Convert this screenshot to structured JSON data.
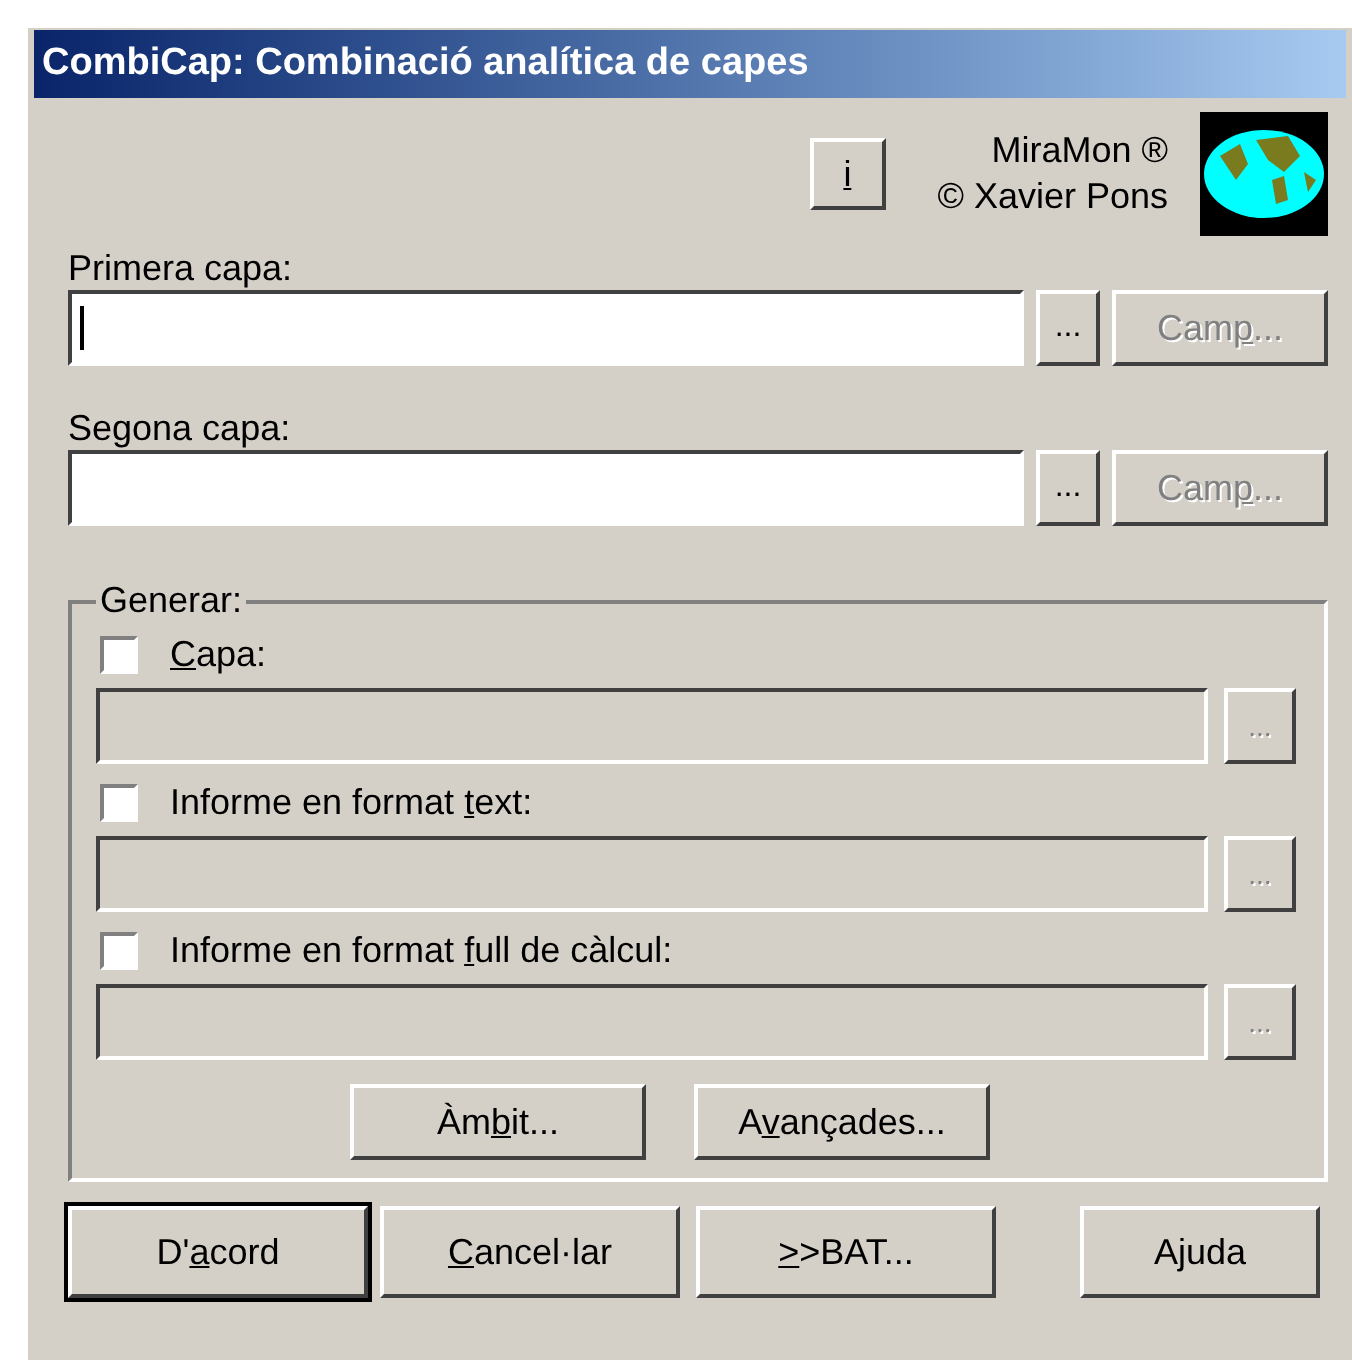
{
  "window": {
    "title": "CombiCap: Combinació analítica de capes"
  },
  "info_button": {
    "label": {
      "key": "i"
    }
  },
  "credits": [
    "MiraMon ®",
    "© Xavier Pons"
  ],
  "layers": [
    {
      "label": "Primera capa:",
      "focused": true,
      "browse": {
        "label": "...",
        "disabled": false
      },
      "field_button": {
        "label": {
          "pre": "Cam",
          "key": "p",
          "post": "..."
        },
        "disabled": true
      }
    },
    {
      "label": "Segona capa:",
      "focused": false,
      "browse": {
        "label": "...",
        "disabled": false
      },
      "field_button": {
        "label": {
          "pre": "Cam",
          "key": "p",
          "post": "..."
        },
        "disabled": true
      }
    }
  ],
  "generate": {
    "title": "Generar:",
    "outputs": [
      {
        "label": {
          "key": "C",
          "post": "apa:"
        },
        "checked": false,
        "disabled": true,
        "browse": {
          "label": "...",
          "disabled": true
        }
      },
      {
        "label": {
          "pre": "Informe en format ",
          "key": "t",
          "post": "ext:"
        },
        "checked": false,
        "disabled": true,
        "browse": {
          "label": "...",
          "disabled": true
        }
      },
      {
        "label": {
          "pre": "Informe en format ",
          "key": "f",
          "post": "ull de càlcul:"
        },
        "checked": false,
        "disabled": true,
        "browse": {
          "label": "...",
          "disabled": true
        }
      }
    ],
    "buttons": [
      {
        "label": {
          "pre": "Àm",
          "key": "b",
          "post": "it..."
        }
      },
      {
        "label": {
          "pre": "A",
          "key": "v",
          "post": "ançades..."
        }
      }
    ]
  },
  "footer_buttons": [
    {
      "label": {
        "pre": "D'",
        "key": "a",
        "post": "cord"
      },
      "default": true
    },
    {
      "label": {
        "key": "C",
        "post": "ancel·lar"
      },
      "default": false
    },
    {
      "label": {
        "key": ">",
        "post": ">BAT..."
      },
      "default": false
    },
    {
      "label": {
        "post": "Ajuda"
      },
      "default": false
    }
  ]
}
